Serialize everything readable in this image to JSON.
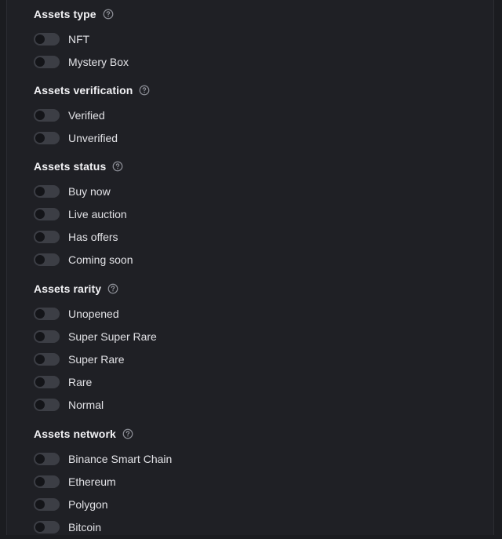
{
  "filters": [
    {
      "title": "Assets type",
      "options": [
        {
          "label": "NFT",
          "on": false
        },
        {
          "label": "Mystery Box",
          "on": false
        }
      ]
    },
    {
      "title": "Assets verification",
      "options": [
        {
          "label": "Verified",
          "on": false
        },
        {
          "label": "Unverified",
          "on": false
        }
      ]
    },
    {
      "title": "Assets status",
      "options": [
        {
          "label": "Buy now",
          "on": false
        },
        {
          "label": "Live auction",
          "on": false
        },
        {
          "label": "Has offers",
          "on": false
        },
        {
          "label": "Coming soon",
          "on": false
        }
      ]
    },
    {
      "title": "Assets rarity",
      "options": [
        {
          "label": "Unopened",
          "on": false
        },
        {
          "label": "Super Super Rare",
          "on": false
        },
        {
          "label": "Super Rare",
          "on": false
        },
        {
          "label": "Rare",
          "on": false
        },
        {
          "label": "Normal",
          "on": false
        }
      ]
    },
    {
      "title": "Assets network",
      "options": [
        {
          "label": "Binance Smart Chain",
          "on": false
        },
        {
          "label": "Ethereum",
          "on": false
        },
        {
          "label": "Polygon",
          "on": false
        },
        {
          "label": "Bitcoin",
          "on": false
        }
      ]
    }
  ],
  "icons": {
    "help": "question-circle-icon"
  },
  "colors": {
    "background": "#1b1c20",
    "panel": "#1f2025",
    "toggle_off": "#3c3e45",
    "text": "#e2e2e6"
  }
}
